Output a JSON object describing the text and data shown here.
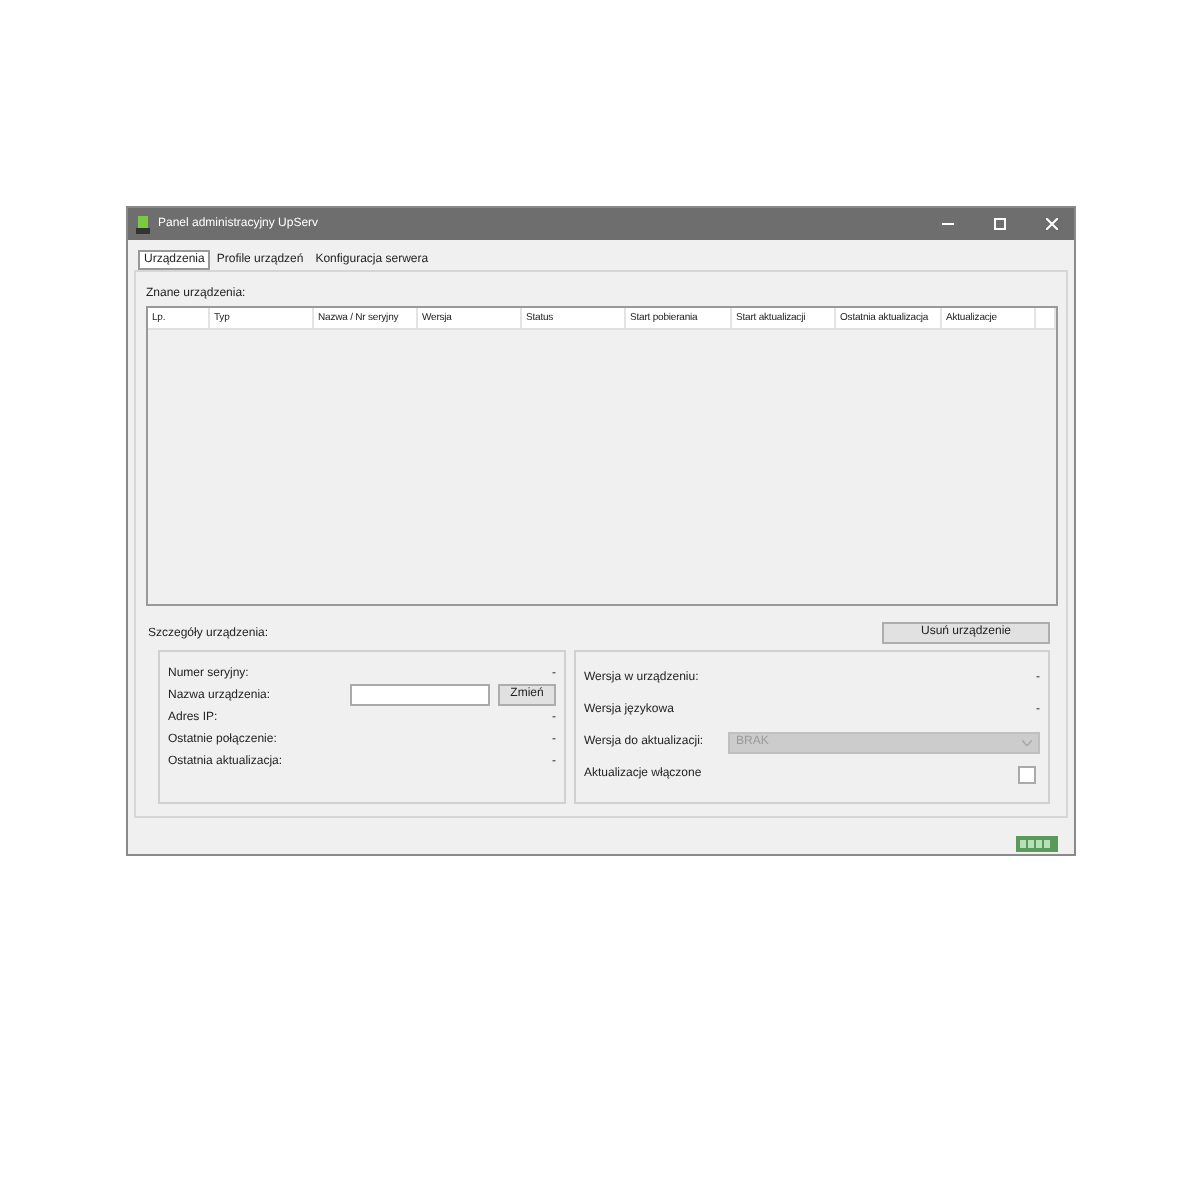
{
  "window": {
    "title": "Panel administracyjny UpServ"
  },
  "tabs": [
    {
      "label": "Urządzenia",
      "selected": true
    },
    {
      "label": "Profile urządzeń",
      "selected": false
    },
    {
      "label": "Konfiguracja serwera",
      "selected": false
    }
  ],
  "devices": {
    "label": "Znane urządzenia:",
    "columns": [
      "Lp.",
      "Typ",
      "Nazwa / Nr seryjny",
      "Wersja",
      "Status",
      "Start pobierania",
      "Start aktualizacji",
      "Ostatnia aktualizacja",
      "Aktualizacje"
    ]
  },
  "details": {
    "label": "Szczegóły urządzenia:",
    "delete_button": "Usuń urządzenie",
    "left": [
      {
        "kind": "text",
        "label": "Numer seryjny:",
        "value": "-"
      },
      {
        "kind": "input",
        "label": "Nazwa urządzenia:",
        "button": "Zmień"
      },
      {
        "kind": "text",
        "label": "Adres IP:",
        "value": "-"
      },
      {
        "kind": "text",
        "label": "Ostatnie połączenie:",
        "value": "-"
      },
      {
        "kind": "text",
        "label": "Ostatnia aktualizacja:",
        "value": "-"
      }
    ],
    "right": [
      {
        "kind": "text",
        "label": "Wersja w urządzeniu:",
        "value": "-"
      },
      {
        "kind": "text",
        "label": "Wersja językowa",
        "value": "-"
      },
      {
        "kind": "select",
        "label": "Wersja do aktualizacji:",
        "value": "BRAK",
        "disabled": true
      },
      {
        "kind": "checkbox",
        "label": "Aktualizacje włączone",
        "checked": false
      }
    ]
  }
}
